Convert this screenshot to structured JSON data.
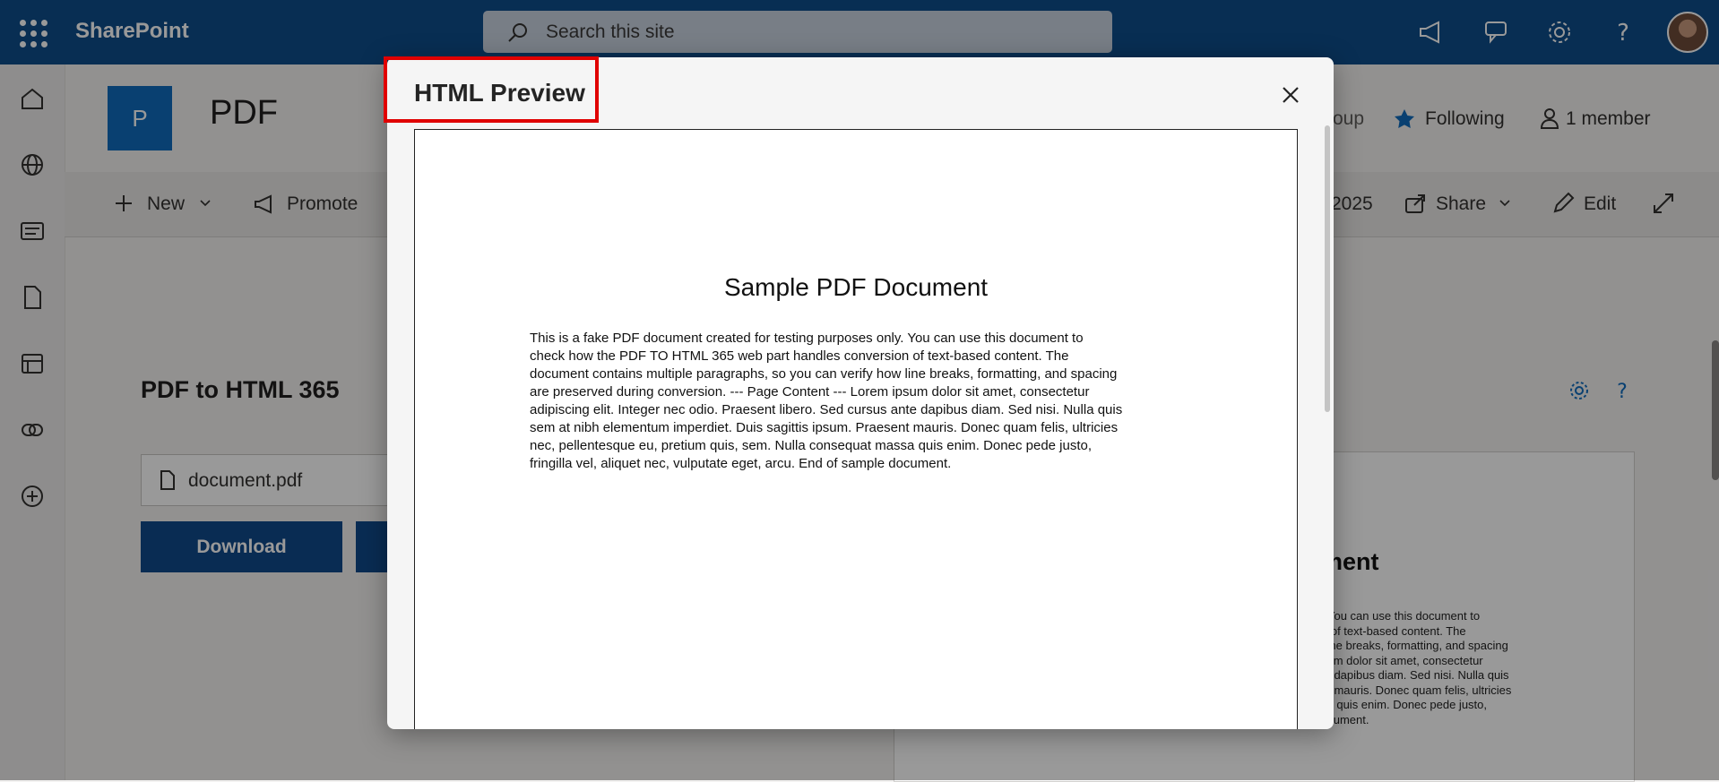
{
  "suite": {
    "brand": "SharePoint",
    "search_placeholder": "Search this site"
  },
  "site": {
    "logo_letter": "P",
    "title": "PDF",
    "group_partial": "roup",
    "following": "Following",
    "members": "1 member"
  },
  "commandbar": {
    "new": "New",
    "promote": "Promote",
    "date_partial": "2025",
    "share": "Share",
    "edit": "Edit"
  },
  "webpart": {
    "title": "PDF to HTML 365",
    "file_name": "document.pdf",
    "download": "Download",
    "preview_heading_partial": "ment",
    "preview_text_partial": ". You can use this document to\nn of text-based content. The\n line breaks, formatting, and spacing\nsum dolor sit amet, consectetur\nte dapibus diam. Sed nisi. Nulla quis\nnt mauris. Donec quam felis, ultricies\nsa quis enim. Donec pede justo,\nocument."
  },
  "modal": {
    "title": "HTML Preview",
    "doc_title": "Sample PDF Document",
    "doc_body": "This is a fake PDF document created for testing purposes only. You can use this document to\ncheck how the PDF TO HTML 365 web part handles conversion of text-based content. The\ndocument contains multiple paragraphs, so you can verify how line breaks, formatting, and spacing\nare preserved during conversion. --- Page Content --- Lorem ipsum dolor sit amet, consectetur\nadipiscing elit. Integer nec odio. Praesent libero. Sed cursus ante dapibus diam. Sed nisi. Nulla quis\nsem at nibh elementum imperdiet. Duis sagittis ipsum. Praesent mauris. Donec quam felis, ultricies\nnec, pellentesque eu, pretium quis, sem. Nulla consequat massa quis enim. Donec pede justo,\nfringilla vel, aliquet nec, vulputate eget, arcu. End of sample document."
  },
  "icons": [
    "app-launcher-icon",
    "search-icon",
    "megaphone-icon",
    "chat-icon",
    "gear-icon",
    "help-icon",
    "home-icon",
    "globe-icon",
    "news-icon",
    "document-icon",
    "list-icon",
    "loop-icon",
    "add-icon",
    "star-icon",
    "person-icon",
    "plus-icon",
    "chevron-down-icon",
    "share-icon",
    "pencil-icon",
    "expand-icon",
    "file-icon",
    "close-icon"
  ],
  "colors": {
    "suitebar": "#0e4d8b",
    "accent": "#0f4a8a",
    "highlight": "#e00000"
  }
}
